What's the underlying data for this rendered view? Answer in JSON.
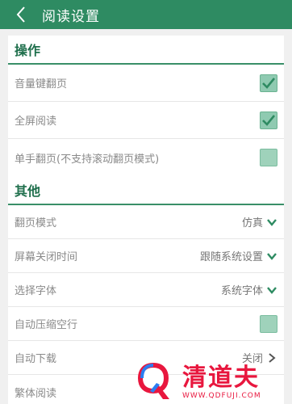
{
  "header": {
    "title": "阅读设置"
  },
  "sections": {
    "operation": {
      "title": "操作",
      "items": [
        {
          "label": "音量键翻页",
          "checked": true
        },
        {
          "label": "全屏阅读",
          "checked": true
        },
        {
          "label": "单手翻页(不支持滚动翻页模式)",
          "checked": false
        }
      ]
    },
    "other": {
      "title": "其他",
      "items": [
        {
          "label": "翻页模式",
          "value": "仿真",
          "control": "dropdown"
        },
        {
          "label": "屏幕关闭时间",
          "value": "跟随系统设置",
          "control": "dropdown"
        },
        {
          "label": "选择字体",
          "value": "系统字体",
          "control": "dropdown"
        },
        {
          "label": "自动压缩空行",
          "checked": false,
          "control": "checkbox"
        },
        {
          "label": "自动下载",
          "value": "关闭",
          "control": "arrow"
        },
        {
          "label": "繁体阅读"
        }
      ]
    }
  },
  "watermark": {
    "brand": "清道夫",
    "url": "WWW.QDFUJI.COM"
  },
  "colors": {
    "header_bg": "#2e8b62",
    "accent": "#3a8f68",
    "checkbox_fill": "#8fcab1",
    "watermark_red": "#e8173e"
  },
  "icons": {
    "back": "chevron-left-icon",
    "check": "check-icon",
    "dropdown": "chevron-down-icon",
    "arrow": "chevron-right-icon"
  }
}
